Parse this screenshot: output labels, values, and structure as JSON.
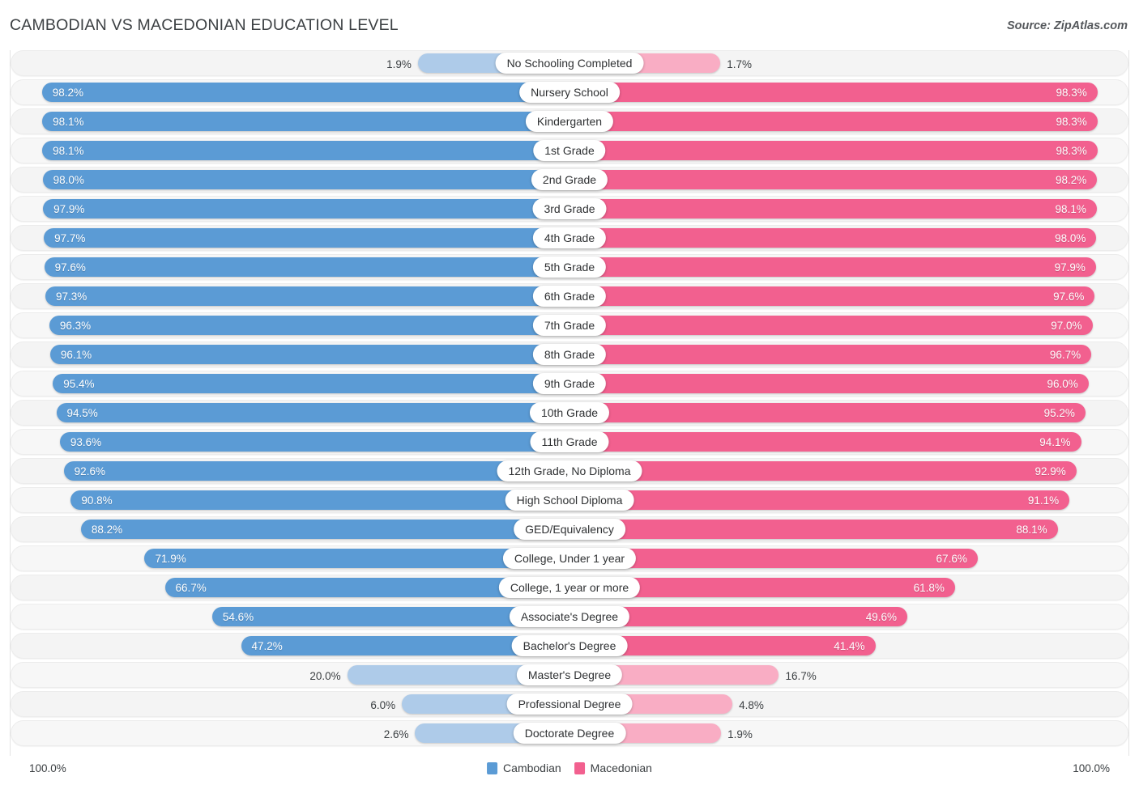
{
  "header": {
    "title": "CAMBODIAN VS MACEDONIAN EDUCATION LEVEL",
    "source": "Source: ZipAtlas.com"
  },
  "axis": {
    "left_max": "100.0%",
    "right_max": "100.0%"
  },
  "legend": {
    "items": [
      {
        "label": "Cambodian",
        "color": "#5b9bd5"
      },
      {
        "label": "Macedonian",
        "color": "#f2608f"
      }
    ]
  },
  "colors": {
    "blue": "#5b9bd5",
    "pink": "#f2608f",
    "blue_light": "#aecbe9",
    "pink_light": "#f9adc4",
    "row_bg": "#f5f5f5",
    "text": "#3c4043"
  },
  "chart_data": {
    "type": "bar",
    "title": "CAMBODIAN VS MACEDONIAN EDUCATION LEVEL",
    "subtitle": "Source: ZipAtlas.com",
    "orientation": "horizontal-diverging",
    "xlabel": "",
    "ylabel": "",
    "xlim": [
      0,
      100
    ],
    "grid": false,
    "legend_position": "bottom-center",
    "categories": [
      "No Schooling Completed",
      "Nursery School",
      "Kindergarten",
      "1st Grade",
      "2nd Grade",
      "3rd Grade",
      "4th Grade",
      "5th Grade",
      "6th Grade",
      "7th Grade",
      "8th Grade",
      "9th Grade",
      "10th Grade",
      "11th Grade",
      "12th Grade, No Diploma",
      "High School Diploma",
      "GED/Equivalency",
      "College, Under 1 year",
      "College, 1 year or more",
      "Associate's Degree",
      "Bachelor's Degree",
      "Master's Degree",
      "Professional Degree",
      "Doctorate Degree"
    ],
    "series": [
      {
        "name": "Cambodian",
        "color": "#5b9bd5",
        "values": [
          1.9,
          98.2,
          98.1,
          98.1,
          98.0,
          97.9,
          97.7,
          97.6,
          97.3,
          96.3,
          96.1,
          95.4,
          94.5,
          93.6,
          92.6,
          90.8,
          88.2,
          71.9,
          66.7,
          54.6,
          47.2,
          20.0,
          6.0,
          2.6
        ],
        "labels": [
          "1.9%",
          "98.2%",
          "98.1%",
          "98.1%",
          "98.0%",
          "97.9%",
          "97.7%",
          "97.6%",
          "97.3%",
          "96.3%",
          "96.1%",
          "95.4%",
          "94.5%",
          "93.6%",
          "92.6%",
          "90.8%",
          "88.2%",
          "71.9%",
          "66.7%",
          "54.6%",
          "47.2%",
          "20.0%",
          "6.0%",
          "2.6%"
        ]
      },
      {
        "name": "Macedonian",
        "color": "#f2608f",
        "values": [
          1.7,
          98.3,
          98.3,
          98.3,
          98.2,
          98.1,
          98.0,
          97.9,
          97.6,
          97.0,
          96.7,
          96.0,
          95.2,
          94.1,
          92.9,
          91.1,
          88.1,
          67.6,
          61.8,
          49.6,
          41.4,
          16.7,
          4.8,
          1.9
        ],
        "labels": [
          "1.7%",
          "98.3%",
          "98.3%",
          "98.3%",
          "98.2%",
          "98.1%",
          "98.0%",
          "97.9%",
          "97.6%",
          "97.0%",
          "96.7%",
          "96.0%",
          "95.2%",
          "94.1%",
          "92.9%",
          "91.1%",
          "88.1%",
          "67.6%",
          "61.8%",
          "49.6%",
          "41.4%",
          "16.7%",
          "4.8%",
          "1.9%"
        ]
      }
    ]
  }
}
